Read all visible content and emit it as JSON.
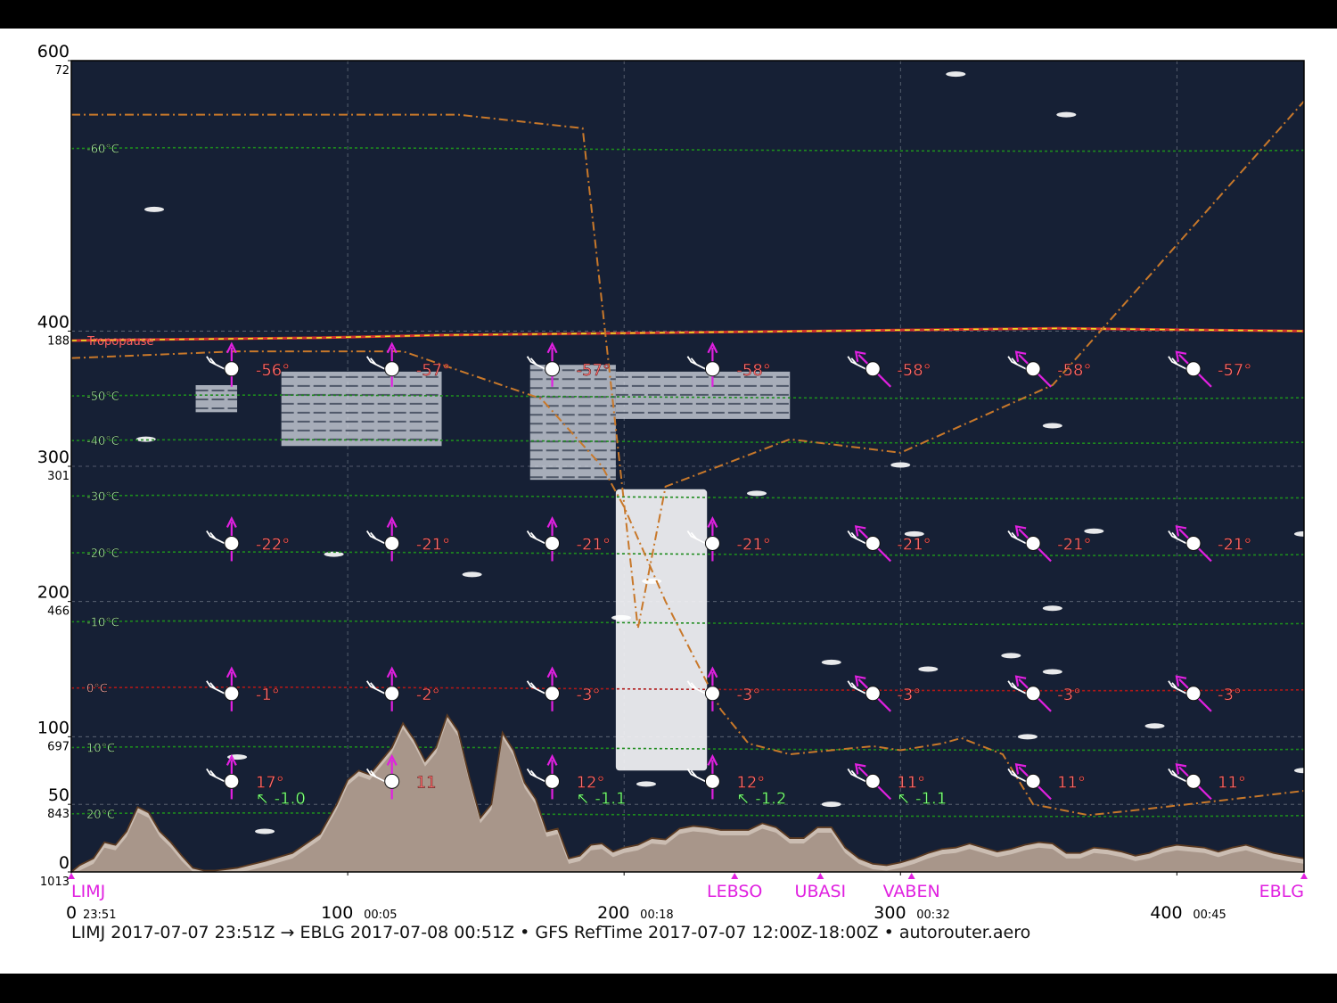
{
  "chart_data": {
    "type": "area",
    "title": "",
    "footer": "LIMJ 2017-07-07 23:51Z → EBLG 2017-07-08 00:51Z • GFS RefTime 2017-07-07 12:00Z-18:00Z • autorouter.aero",
    "xlim": [
      0,
      446
    ],
    "ylim": [
      0,
      600
    ],
    "colors": {
      "plot_bg": "#162035",
      "terrain_fill": "#a8968a",
      "terrain_fill_light": "#cbbdb2",
      "terrain_line": "#5a3a22",
      "isotherm": "#1e8c1e",
      "isotherm_zero": "#b01818",
      "temp_label": "#b8ffb8",
      "tropopause": "#e8e020",
      "tropopause_shadow": "#d03030",
      "route": "#c8782a",
      "wind_arrow": "#e020e0",
      "temp_value": "#ff7070",
      "vs_value": "#80ff80",
      "waypoint": "#e020e0",
      "grid": "#9aa0aa"
    },
    "y_ticks": [
      {
        "fl": "600",
        "hpa": "72",
        "y": 600
      },
      {
        "fl": "400",
        "hpa": "188",
        "y": 400
      },
      {
        "fl": "300",
        "hpa": "301",
        "y": 300
      },
      {
        "fl": "200",
        "hpa": "466",
        "y": 200
      },
      {
        "fl": "100",
        "hpa": "697",
        "y": 100
      },
      {
        "fl": "50",
        "hpa": "843",
        "y": 50
      },
      {
        "fl": "0",
        "hpa": "1013",
        "y": 0
      }
    ],
    "x_ticks": [
      {
        "x": 0,
        "label": "0",
        "time": "23:51"
      },
      {
        "x": 100,
        "label": "100",
        "time": "00:05"
      },
      {
        "x": 200,
        "label": "200",
        "time": "00:18"
      },
      {
        "x": 300,
        "label": "300",
        "time": "00:32"
      },
      {
        "x": 400,
        "label": "400",
        "time": "00:45"
      }
    ],
    "waypoints": [
      {
        "name": "LIMJ",
        "x": 0
      },
      {
        "name": "LEBSO",
        "x": 240
      },
      {
        "name": "UBASI",
        "x": 271
      },
      {
        "name": "VABEN",
        "x": 304
      },
      {
        "name": "EBLG",
        "x": 446
      }
    ],
    "isotherms": [
      {
        "label": "-60°C",
        "y": 535,
        "zero": false
      },
      {
        "label": "-50°C",
        "y": 352,
        "zero": false
      },
      {
        "label": "-40°C",
        "y": 319,
        "zero": false
      },
      {
        "label": "-30°C",
        "y": 278,
        "zero": false
      },
      {
        "label": "-20°C",
        "y": 236,
        "zero": false
      },
      {
        "label": "-10°C",
        "y": 185,
        "zero": false
      },
      {
        "label": "0°C",
        "y": 136,
        "zero": true
      },
      {
        "label": "10°C",
        "y": 92,
        "zero": false
      },
      {
        "label": "20°C",
        "y": 43,
        "zero": false
      }
    ],
    "tropopause": {
      "label": "Tropopause",
      "y": [
        393,
        394,
        395,
        397,
        398,
        399,
        400,
        401,
        402,
        401,
        400
      ]
    },
    "wind_rows": [
      {
        "y": 372,
        "x": [
          58,
          116,
          174,
          232,
          290,
          348,
          406
        ],
        "temps": [
          "-56°",
          "-57°",
          "-57°",
          "-58°",
          "-58°",
          "-58°",
          "-57°"
        ],
        "dir": [
          "n",
          "n",
          "n",
          "n",
          "nw",
          "nw",
          "nw"
        ],
        "vs": []
      },
      {
        "y": 243,
        "x": [
          58,
          116,
          174,
          232,
          290,
          348,
          406
        ],
        "temps": [
          "-22°",
          "-21°",
          "-21°",
          "-21°",
          "-21°",
          "-21°",
          "-21°"
        ],
        "dir": [
          "n",
          "n",
          "n",
          "n",
          "nw",
          "nw",
          "nw"
        ],
        "vs": []
      },
      {
        "y": 132,
        "x": [
          58,
          116,
          174,
          232,
          290,
          348,
          406
        ],
        "temps": [
          "-1°",
          "-2°",
          "-3°",
          "-3°",
          "-3°",
          "-3°",
          "-3°"
        ],
        "dir": [
          "n",
          "n",
          "n",
          "n",
          "nw",
          "nw",
          "nw"
        ],
        "vs": []
      },
      {
        "y": 67,
        "x": [
          58,
          116,
          174,
          232,
          290,
          348,
          406
        ],
        "temps": [
          "17°",
          "11",
          "12°",
          "12°",
          "11°",
          "11°",
          "11°"
        ],
        "dir": [
          "n",
          "n",
          "n",
          "n",
          "nw",
          "nw",
          "nw"
        ],
        "vs": [
          "↖ -1.0",
          "",
          "↖ -1.1",
          "↖ -1.2",
          "↖ -1.1",
          "",
          ""
        ]
      }
    ],
    "terrain": {
      "x": [
        0,
        3,
        8,
        12,
        16,
        20,
        24,
        28,
        32,
        36,
        40,
        44,
        48,
        52,
        56,
        60,
        64,
        70,
        80,
        90,
        96,
        100,
        104,
        108,
        112,
        116,
        120,
        124,
        128,
        132,
        136,
        140,
        144,
        148,
        152,
        156,
        160,
        164,
        168,
        172,
        176,
        180,
        184,
        188,
        192,
        196,
        200,
        205,
        210,
        215,
        220,
        225,
        230,
        235,
        240,
        245,
        250,
        255,
        260,
        265,
        270,
        275,
        280,
        285,
        290,
        295,
        300,
        305,
        310,
        315,
        320,
        325,
        330,
        335,
        340,
        345,
        350,
        355,
        360,
        365,
        370,
        375,
        380,
        385,
        390,
        395,
        400,
        405,
        410,
        415,
        420,
        425,
        430,
        435,
        440,
        446
      ],
      "y": [
        0,
        5,
        10,
        22,
        20,
        30,
        48,
        44,
        30,
        22,
        12,
        3,
        1,
        1,
        2,
        3,
        5,
        8,
        14,
        28,
        50,
        68,
        75,
        72,
        82,
        92,
        110,
        98,
        82,
        92,
        116,
        104,
        70,
        40,
        50,
        103,
        90,
        66,
        54,
        30,
        32,
        10,
        12,
        20,
        21,
        15,
        18,
        20,
        25,
        24,
        32,
        34,
        33,
        31,
        31,
        31,
        36,
        33,
        25,
        25,
        33,
        33,
        18,
        10,
        6,
        5,
        7,
        10,
        14,
        17,
        18,
        21,
        18,
        15,
        17,
        20,
        22,
        21,
        14,
        14,
        18,
        17,
        15,
        12,
        14,
        18,
        20,
        19,
        18,
        15,
        18,
        20,
        17,
        14,
        12,
        10
      ]
    },
    "route": {
      "x": [
        0,
        60,
        120,
        170,
        192,
        200,
        215,
        235,
        245,
        260,
        275,
        290,
        300,
        315,
        322,
        337,
        348,
        368,
        382,
        404,
        425,
        446
      ],
      "y": [
        380,
        385,
        385,
        350,
        300,
        270,
        200,
        120,
        95,
        87,
        90,
        93,
        90,
        95,
        99,
        87,
        50,
        42,
        45,
        50,
        55,
        60
      ]
    },
    "route2": {
      "x": [
        0,
        140,
        185,
        205,
        215,
        260,
        300,
        355,
        446
      ],
      "y": [
        560,
        560,
        550,
        180,
        285,
        320,
        310,
        360,
        570
      ]
    },
    "cloud_blocks": [
      {
        "x0": 45,
        "x1": 60,
        "y0": 340,
        "y1": 360
      },
      {
        "x0": 76,
        "x1": 134,
        "y0": 315,
        "y1": 370
      },
      {
        "x0": 166,
        "x1": 197,
        "y0": 290,
        "y1": 375
      },
      {
        "x0": 197,
        "x1": 260,
        "y0": 335,
        "y1": 370
      }
    ],
    "cloud_column": {
      "x0": 197,
      "x1": 230,
      "y0": 75,
      "y1": 283
    }
  }
}
